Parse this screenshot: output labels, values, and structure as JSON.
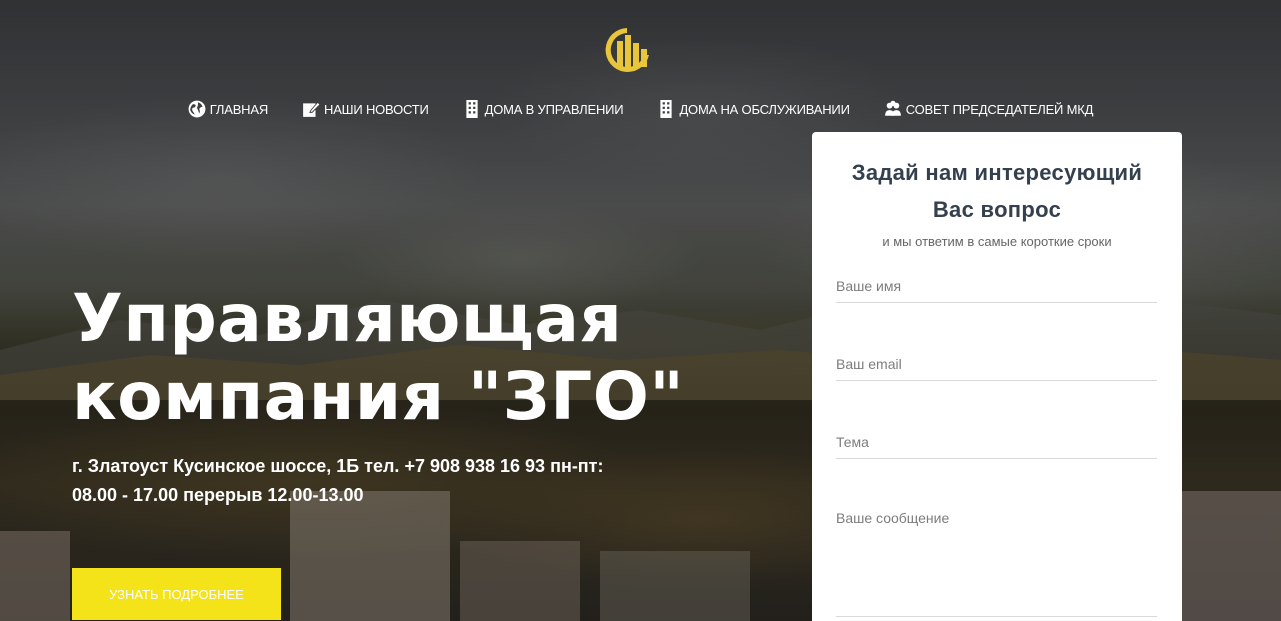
{
  "nav": {
    "items": [
      {
        "label": "ГЛАВНАЯ",
        "icon": "globe-icon"
      },
      {
        "label": "НАШИ НОВОСТИ",
        "icon": "edit-icon"
      },
      {
        "label": "ДОМА В УПРАВЛЕНИИ",
        "icon": "building-icon"
      },
      {
        "label": "ДОМА НА ОБСЛУЖИВАНИИ",
        "icon": "building-icon"
      },
      {
        "label": "СОВЕТ ПРЕДСЕДАТЕЛЕЙ МКД",
        "icon": "group-icon"
      }
    ]
  },
  "hero": {
    "title_line1": "Управляющая",
    "title_line2": "компания \"ЗГО\"",
    "address_line1": "г. Златоуст Кусинское шоссе, 1Б тел. +7 908 938 16 93 пн-пт:",
    "address_line2": "08.00 - 17.00 перерыв 12.00-13.00",
    "cta_label": "УЗНАТЬ ПОДРОБНЕЕ"
  },
  "form": {
    "title": "Задай нам интересующий Вас вопрос",
    "subtitle": "и мы ответим в самые короткие сроки",
    "name_placeholder": "Ваше имя",
    "email_placeholder": "Ваш email",
    "subject_placeholder": "Тема",
    "message_placeholder": "Ваше сообщение"
  },
  "colors": {
    "accent": "#f5e31a",
    "logo": "#e8c53a",
    "form_title": "#35404f"
  }
}
